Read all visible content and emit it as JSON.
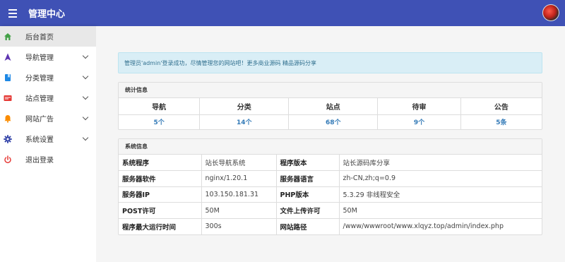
{
  "header": {
    "title": "管理中心"
  },
  "sidebar": {
    "items": [
      {
        "label": "后台首页",
        "icon": "home-icon",
        "color": "#43a047",
        "expandable": false
      },
      {
        "label": "导航管理",
        "icon": "navigation-icon",
        "color": "#5e35b1",
        "expandable": true
      },
      {
        "label": "分类管理",
        "icon": "bookmark-icon",
        "color": "#1e88e5",
        "expandable": true
      },
      {
        "label": "站点管理",
        "icon": "web-icon",
        "color": "#e53935",
        "expandable": true
      },
      {
        "label": "网站广告",
        "icon": "bell-icon",
        "color": "#fb8c00",
        "expandable": true
      },
      {
        "label": "系统设置",
        "icon": "gear-icon",
        "color": "#3949ab",
        "expandable": true
      },
      {
        "label": "退出登录",
        "icon": "power-icon",
        "color": "#e53935",
        "expandable": false
      }
    ]
  },
  "alert": {
    "text": "管理员'admin'登录成功，尽情管理您的网站吧！更多商业源码 精品源码分享"
  },
  "stats": {
    "title": "统计信息",
    "headers": [
      "导航",
      "分类",
      "站点",
      "待审",
      "公告"
    ],
    "values": [
      "5个",
      "14个",
      "68个",
      "9个",
      "5条"
    ]
  },
  "system": {
    "title": "系统信息",
    "rows": [
      [
        "系统程序",
        "站长导航系统",
        "程序版本",
        "站长源码库分享"
      ],
      [
        "服务器软件",
        "nginx/1.20.1",
        "服务器语言",
        "zh-CN,zh;q=0.9"
      ],
      [
        "服务器IP",
        "103.150.181.31",
        "PHP版本",
        "5.3.29 非线程安全"
      ],
      [
        "POST许可",
        "50M",
        "文件上传许可",
        "50M"
      ],
      [
        "程序最大运行时间",
        "300s",
        "网站路径",
        "/www/wwwroot/www.xlqyz.top/admin/index.php"
      ]
    ]
  },
  "colors": {
    "header": "#3f51b5",
    "link": "#337ab7",
    "alert_bg": "#d9eef6"
  }
}
